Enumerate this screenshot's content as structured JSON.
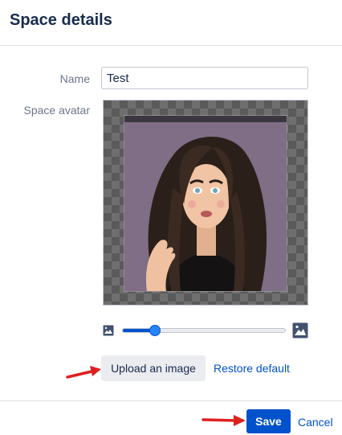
{
  "dialog": {
    "title": "Space details"
  },
  "form": {
    "name_label": "Name",
    "name_value": "Test",
    "avatar_label": "Space avatar"
  },
  "avatar": {
    "zoom_fraction": 0.2,
    "image_description_icon": "image-icon"
  },
  "actions": {
    "upload_label": "Upload an image",
    "restore_label": "Restore default"
  },
  "footer": {
    "save_label": "Save",
    "cancel_label": "Cancel"
  },
  "colors": {
    "primary": "#0052cc",
    "text": "#172b4d",
    "muted": "#6b778c",
    "annotation_arrow": "#e02020"
  }
}
